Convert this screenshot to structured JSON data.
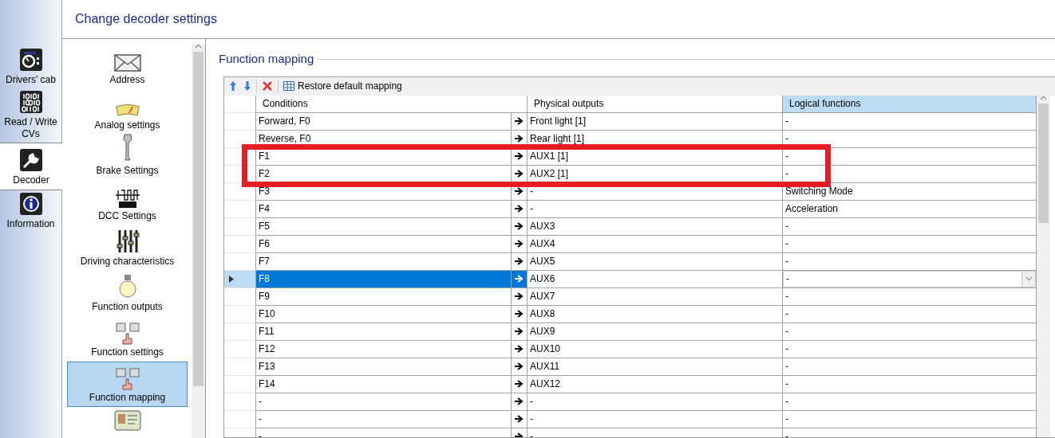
{
  "nav_tabs": [
    {
      "label": "Drivers' cab",
      "selected": false
    },
    {
      "label": "Read / Write CVs",
      "selected": false
    },
    {
      "label": "Decoder",
      "selected": true
    },
    {
      "label": "Information",
      "selected": false
    }
  ],
  "header": {
    "title": "Change decoder settings"
  },
  "sidebar": {
    "items": [
      {
        "label": "Address",
        "selected": false
      },
      {
        "label": "Analog settings",
        "selected": false
      },
      {
        "label": "Brake Settings",
        "selected": false
      },
      {
        "label": "DCC Settings",
        "selected": false
      },
      {
        "label": "Driving characteristics",
        "selected": false
      },
      {
        "label": "Function outputs",
        "selected": false
      },
      {
        "label": "Function settings",
        "selected": false
      },
      {
        "label": "Function mapping",
        "selected": true
      }
    ]
  },
  "group": {
    "title": "Function mapping"
  },
  "toolbar": {
    "restore_button": "Restore default mapping"
  },
  "table": {
    "columns": [
      {
        "label": "Conditions",
        "selected": false
      },
      {
        "label": "Physical outputs",
        "selected": false
      },
      {
        "label": "Logical functions",
        "selected": true
      }
    ],
    "rows": [
      {
        "condition": "Forward, F0",
        "output": "Front light [1]",
        "function": "-",
        "selected": false,
        "highlighted": false
      },
      {
        "condition": "Reverse, F0",
        "output": "Rear light [1]",
        "function": "-",
        "selected": false,
        "highlighted": false
      },
      {
        "condition": "F1",
        "output": "AUX1 [1]",
        "function": "-",
        "selected": false,
        "highlighted": true
      },
      {
        "condition": "F2",
        "output": "AUX2 [1]",
        "function": "-",
        "selected": false,
        "highlighted": true
      },
      {
        "condition": "F3",
        "output": "-",
        "function": "Switching Mode",
        "selected": false,
        "highlighted": false
      },
      {
        "condition": "F4",
        "output": "-",
        "function": "Acceleration",
        "selected": false,
        "highlighted": false
      },
      {
        "condition": "F5",
        "output": "AUX3",
        "function": "-",
        "selected": false,
        "highlighted": false
      },
      {
        "condition": "F6",
        "output": "AUX4",
        "function": "-",
        "selected": false,
        "highlighted": false
      },
      {
        "condition": "F7",
        "output": "AUX5",
        "function": "-",
        "selected": false,
        "highlighted": false
      },
      {
        "condition": "F8",
        "output": "AUX6",
        "function": "-",
        "selected": true,
        "highlighted": false
      },
      {
        "condition": "F9",
        "output": "AUX7",
        "function": "-",
        "selected": false,
        "highlighted": false
      },
      {
        "condition": "F10",
        "output": "AUX8",
        "function": "-",
        "selected": false,
        "highlighted": false
      },
      {
        "condition": "F11",
        "output": "AUX9",
        "function": "-",
        "selected": false,
        "highlighted": false
      },
      {
        "condition": "F12",
        "output": "AUX10",
        "function": "-",
        "selected": false,
        "highlighted": false
      },
      {
        "condition": "F13",
        "output": "AUX11",
        "function": "-",
        "selected": false,
        "highlighted": false
      },
      {
        "condition": "F14",
        "output": "AUX12",
        "function": "-",
        "selected": false,
        "highlighted": false
      },
      {
        "condition": "-",
        "output": "-",
        "function": "-",
        "selected": false,
        "highlighted": false
      },
      {
        "condition": "-",
        "output": "-",
        "function": "-",
        "selected": false,
        "highlighted": false
      },
      {
        "condition": "-",
        "output": "-",
        "function": "-",
        "selected": false,
        "highlighted": false
      }
    ]
  }
}
